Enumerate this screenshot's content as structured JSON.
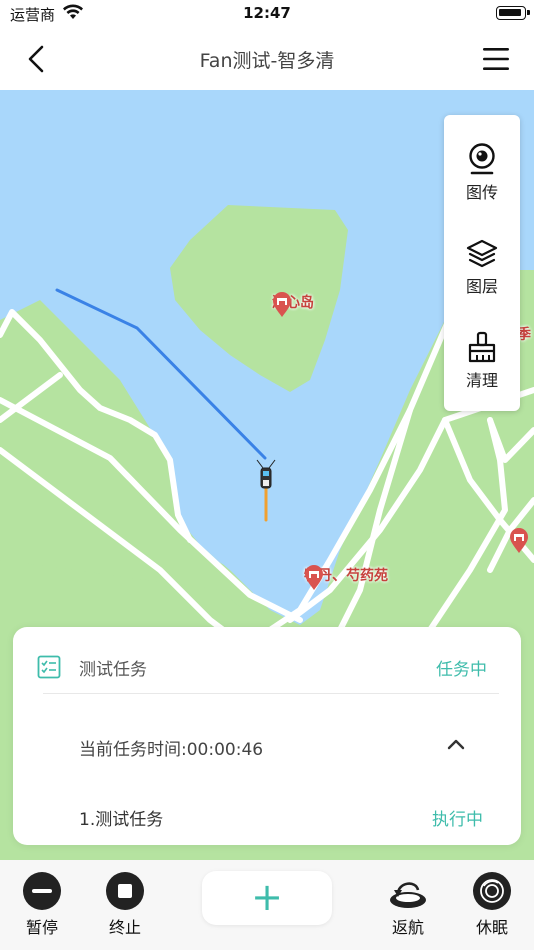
{
  "status_bar": {
    "carrier": "运营商",
    "time": "12:47"
  },
  "navbar": {
    "title": "Fan测试-智多清"
  },
  "map": {
    "pois": [
      {
        "label": "湖心岛"
      },
      {
        "label": "牡丹、芍药苑"
      },
      {
        "label": "季"
      }
    ]
  },
  "tools": [
    {
      "label": "图传",
      "icon": "camera-icon"
    },
    {
      "label": "图层",
      "icon": "layers-icon"
    },
    {
      "label": "清理",
      "icon": "brush-icon"
    }
  ],
  "task_panel": {
    "task_name": "测试任务",
    "task_status": "任务中",
    "timer_label": "当前任务时间:00:00:46",
    "subtask_name": "1.测试任务",
    "subtask_status": "执行中"
  },
  "bottom_bar": {
    "pause": "暂停",
    "stop": "终止",
    "add": "+",
    "return": "返航",
    "sleep": "休眠"
  },
  "colors": {
    "accent": "#3ebcab",
    "water": "#a9d7fb",
    "land": "#b5e3a0",
    "route": "#3a82e6",
    "heading": "#f0a030"
  }
}
